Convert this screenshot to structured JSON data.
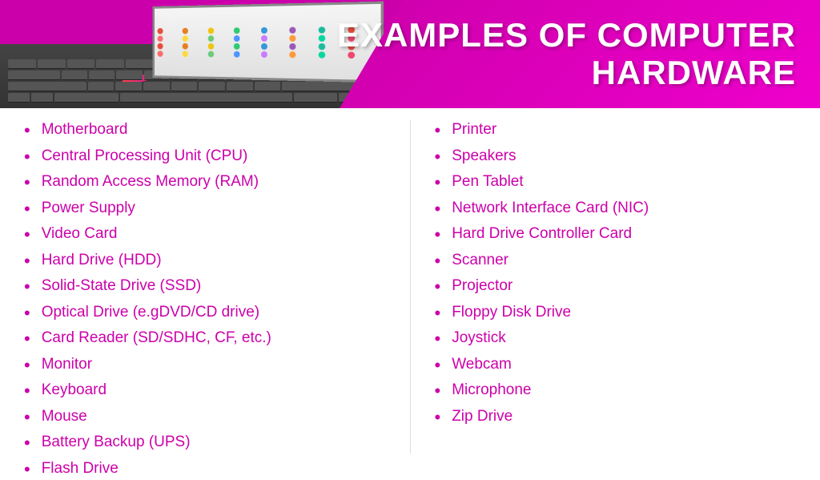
{
  "header": {
    "title_line1": "EXAMPLES OF COMPUTER",
    "title_line2": "HARDWARE"
  },
  "left_column": {
    "items": [
      "Motherboard",
      "Central Processing Unit (CPU)",
      "Random Access Memory (RAM)",
      "Power Supply",
      "Video Card",
      "Hard Drive (HDD)",
      "Solid-State Drive (SSD)",
      "Optical Drive (e.gDVD/CD drive)",
      "Card Reader (SD/SDHC, CF, etc.)",
      "Monitor",
      "Keyboard",
      "Mouse",
      "Battery Backup (UPS)",
      "Flash Drive"
    ]
  },
  "right_column": {
    "items": [
      "Printer",
      "Speakers",
      "Pen Tablet",
      "Network Interface Card (NIC)",
      "Hard Drive Controller Card",
      "Scanner",
      "Projector",
      "Floppy Disk Drive",
      "Joystick",
      "Webcam",
      "Microphone",
      "Zip Drive"
    ]
  },
  "colors": {
    "accent": "#cc00aa",
    "header_bg": "#cc00aa",
    "text": "#cc00aa",
    "white": "#ffffff"
  },
  "screen_dots": [
    "#e74c3c",
    "#e67e22",
    "#f1c40f",
    "#2ecc71",
    "#3498db",
    "#9b59b6",
    "#1abc9c",
    "#e74c3c",
    "#ff6b6b",
    "#ffd93d",
    "#6bcb77",
    "#4d96ff",
    "#c77dff",
    "#ff9a3c",
    "#06d6a0",
    "#ef476f",
    "#e74c3c",
    "#e67e22",
    "#f1c40f",
    "#2ecc71",
    "#3498db",
    "#9b59b6",
    "#1abc9c",
    "#e74c3c",
    "#ff6b6b",
    "#ffd93d",
    "#6bcb77",
    "#4d96ff",
    "#c77dff",
    "#ff9a3c",
    "#06d6a0",
    "#ef476f"
  ]
}
